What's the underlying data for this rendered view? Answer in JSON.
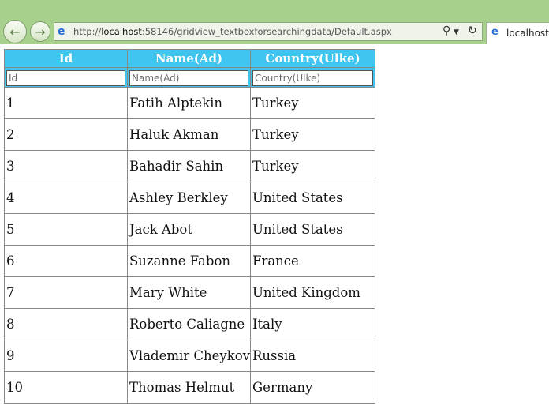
{
  "browser": {
    "url_prefix": "http://",
    "url_host": "localhost",
    "url_rest": ":58146/gridview_textboxforsearchingdata/Default.aspx",
    "tab_title": "localhost"
  },
  "grid": {
    "headers": [
      "Id",
      "Name(Ad)",
      "Country(Ulke)"
    ],
    "filters": [
      {
        "placeholder": "Id",
        "value": ""
      },
      {
        "placeholder": "Name(Ad)",
        "value": ""
      },
      {
        "placeholder": "Country(Ulke)",
        "value": ""
      }
    ],
    "rows": [
      [
        "1",
        "Fatih Alptekin",
        "Turkey"
      ],
      [
        "2",
        "Haluk Akman",
        "Turkey"
      ],
      [
        "3",
        "Bahadir Sahin",
        "Turkey"
      ],
      [
        "4",
        "Ashley Berkley",
        "United States"
      ],
      [
        "5",
        "Jack Abot",
        "United States"
      ],
      [
        "6",
        "Suzanne Fabon",
        "France"
      ],
      [
        "7",
        "Mary White",
        "United Kingdom"
      ],
      [
        "8",
        "Roberto Caliagne",
        "Italy"
      ],
      [
        "9",
        "Vlademir Cheykov",
        "Russia"
      ],
      [
        "10",
        "Thomas Helmut",
        "Germany"
      ]
    ]
  },
  "colors": {
    "header_bg": "#3fc5f0",
    "chrome_bg": "#a8d08d"
  }
}
